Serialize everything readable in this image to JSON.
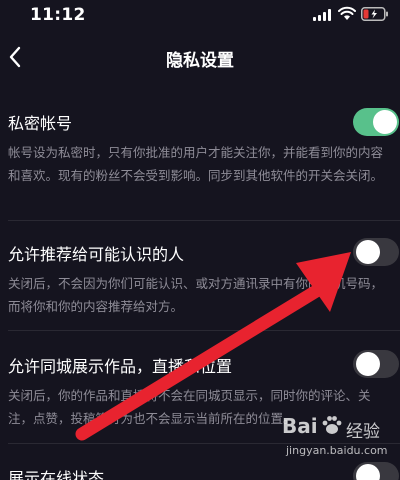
{
  "status_bar": {
    "time": "11:12",
    "icons": [
      "signal-icon",
      "wifi-icon",
      "battery-icon"
    ]
  },
  "nav": {
    "back_icon": "chevron-left-icon",
    "title": "隐私设置"
  },
  "settings": [
    {
      "title": "私密帐号",
      "description": "帐号设为私密时，只有你批准的用户才能关注你，并能看到你的内容和喜欢。现有的粉丝不会受到影响。同步到其他软件的开关会关闭。",
      "enabled": true
    },
    {
      "title": "允许推荐给可能认识的人",
      "description": "关闭后，不会因为你们可能认识、或对方通讯录中有你的手机号码，而将你和你的内容推荐给对方。",
      "enabled": false
    },
    {
      "title": "允许同城展示作品，直播和位置",
      "description": "关闭后，你的作品和直播将不会在同城页显示，同时你的评论、关注，点赞，投稿等行为也不会显示当前所在的位置。",
      "enabled": false
    },
    {
      "title": "展示在线状态",
      "enabled": false
    }
  ],
  "colors": {
    "background": "#15141f",
    "toggle_on": "#58c18b",
    "toggle_off": "#39383f",
    "annotation_arrow": "#e8232f"
  },
  "watermark": {
    "brand": "Bai",
    "brand_suffix": "经验",
    "url": "jingyan.baidu.com"
  }
}
